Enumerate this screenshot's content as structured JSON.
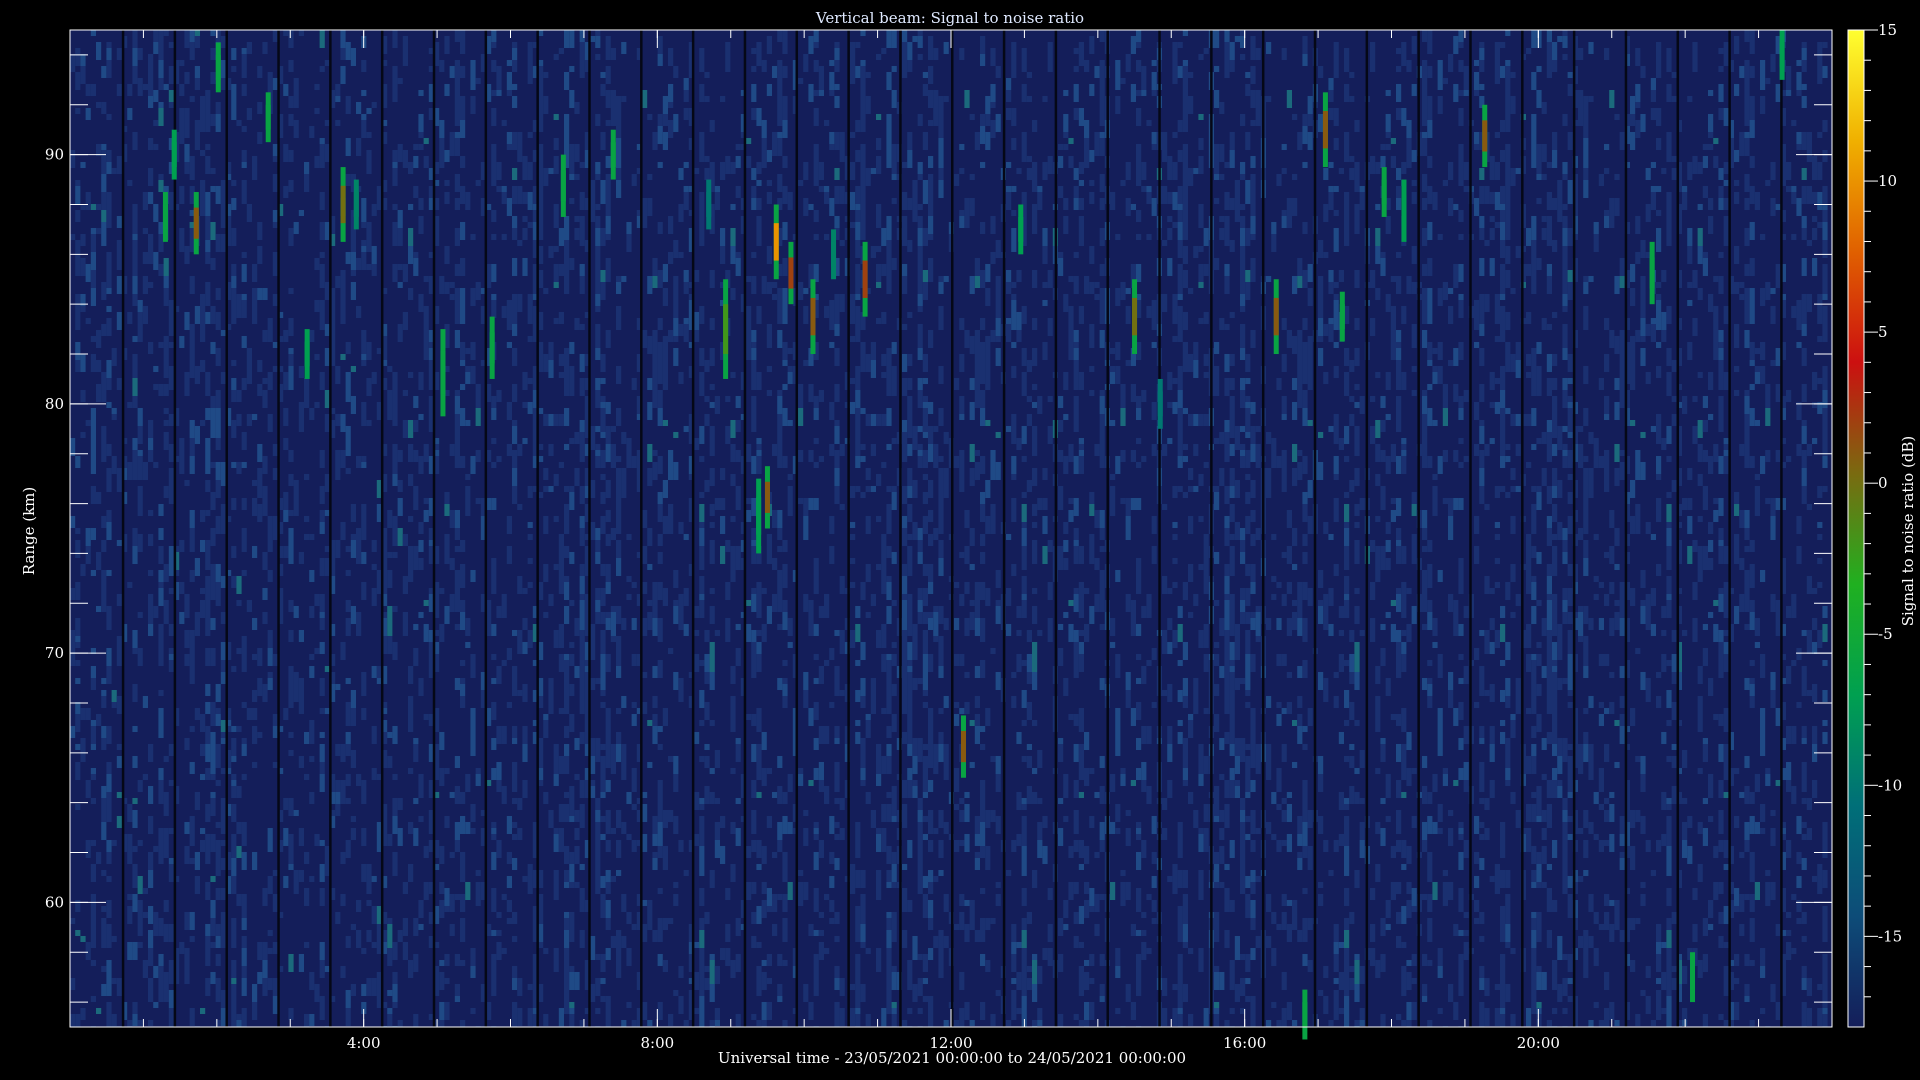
{
  "chart_data": {
    "type": "heatmap",
    "title": "Vertical beam: Signal to noise ratio",
    "xlabel": "Universal time - 23/05/2021 00:00:00 to 24/05/2021 00:00:00",
    "ylabel": "Range (km)",
    "x_unit": "hours UT",
    "xlim": [
      0,
      24
    ],
    "ylim": [
      55,
      95
    ],
    "x_ticks": [
      {
        "value": 4,
        "label": "4:00"
      },
      {
        "value": 8,
        "label": "8:00"
      },
      {
        "value": 12,
        "label": "12:00"
      },
      {
        "value": 16,
        "label": "16:00"
      },
      {
        "value": 20,
        "label": "20:00"
      }
    ],
    "y_ticks": [
      {
        "value": 60,
        "label": "60"
      },
      {
        "value": 70,
        "label": "70"
      },
      {
        "value": 80,
        "label": "80"
      },
      {
        "value": 90,
        "label": "90"
      }
    ],
    "colorbar": {
      "label": "Signal to noise ratio (dB)",
      "range": [
        -18,
        15
      ],
      "ticks": [
        {
          "value": 15,
          "label": "15"
        },
        {
          "value": 10,
          "label": "10"
        },
        {
          "value": 5,
          "label": "5"
        },
        {
          "value": 0,
          "label": "0"
        },
        {
          "value": -5,
          "label": "-5"
        },
        {
          "value": -10,
          "label": "-10"
        },
        {
          "value": -15,
          "label": "-15"
        }
      ],
      "colors": [
        "#141e5a",
        "#0d4c78",
        "#006f78",
        "#00a050",
        "#20b020",
        "#7a6a10",
        "#cc1010",
        "#e06000",
        "#f0b000",
        "#ffff30"
      ]
    },
    "background_snr": -17,
    "echoes": [
      {
        "t": 1.3,
        "r0": 86.5,
        "r1": 88.5,
        "snr": -6
      },
      {
        "t": 1.42,
        "r0": 89.0,
        "r1": 91.0,
        "snr": -7
      },
      {
        "t": 1.72,
        "r0": 86.0,
        "r1": 88.5,
        "snr": 1
      },
      {
        "t": 2.02,
        "r0": 92.5,
        "r1": 94.5,
        "snr": -6
      },
      {
        "t": 2.7,
        "r0": 90.5,
        "r1": 92.5,
        "snr": -6
      },
      {
        "t": 3.23,
        "r0": 81.0,
        "r1": 83.0,
        "snr": -7
      },
      {
        "t": 3.72,
        "r0": 86.5,
        "r1": 89.5,
        "snr": 0
      },
      {
        "t": 3.9,
        "r0": 87.0,
        "r1": 89.0,
        "snr": -9
      },
      {
        "t": 5.08,
        "r0": 79.5,
        "r1": 83.0,
        "snr": -6
      },
      {
        "t": 5.75,
        "r0": 81.0,
        "r1": 83.5,
        "snr": -6
      },
      {
        "t": 6.72,
        "r0": 87.5,
        "r1": 90.0,
        "snr": -6
      },
      {
        "t": 7.4,
        "r0": 89.0,
        "r1": 91.0,
        "snr": -6
      },
      {
        "t": 8.7,
        "r0": 87.0,
        "r1": 89.0,
        "snr": -10
      },
      {
        "t": 8.93,
        "r0": 81.0,
        "r1": 85.0,
        "snr": -2
      },
      {
        "t": 9.38,
        "r0": 74.0,
        "r1": 77.0,
        "snr": -7
      },
      {
        "t": 9.5,
        "r0": 75.0,
        "r1": 77.5,
        "snr": 1
      },
      {
        "t": 9.62,
        "r0": 85.0,
        "r1": 88.0,
        "snr": 10
      },
      {
        "t": 9.82,
        "r0": 84.0,
        "r1": 86.5,
        "snr": 2
      },
      {
        "t": 10.12,
        "r0": 82.0,
        "r1": 85.0,
        "snr": 1
      },
      {
        "t": 10.4,
        "r0": 85.0,
        "r1": 87.0,
        "snr": -9
      },
      {
        "t": 10.83,
        "r0": 83.5,
        "r1": 86.5,
        "snr": 2
      },
      {
        "t": 12.17,
        "r0": 65.0,
        "r1": 67.5,
        "snr": 1
      },
      {
        "t": 12.95,
        "r0": 86.0,
        "r1": 88.0,
        "snr": -7
      },
      {
        "t": 14.5,
        "r0": 82.0,
        "r1": 85.0,
        "snr": 0
      },
      {
        "t": 14.85,
        "r0": 79.0,
        "r1": 81.0,
        "snr": -10
      },
      {
        "t": 16.43,
        "r0": 82.0,
        "r1": 85.0,
        "snr": 1
      },
      {
        "t": 16.82,
        "r0": 54.5,
        "r1": 56.5,
        "snr": -6
      },
      {
        "t": 17.1,
        "r0": 89.5,
        "r1": 92.5,
        "snr": 1
      },
      {
        "t": 17.33,
        "r0": 82.5,
        "r1": 84.5,
        "snr": -6
      },
      {
        "t": 17.9,
        "r0": 87.5,
        "r1": 89.5,
        "snr": -6
      },
      {
        "t": 18.17,
        "r0": 86.5,
        "r1": 89.0,
        "snr": -7
      },
      {
        "t": 19.27,
        "r0": 89.5,
        "r1": 92.0,
        "snr": 1
      },
      {
        "t": 21.55,
        "r0": 84.0,
        "r1": 86.5,
        "snr": -6
      },
      {
        "t": 22.1,
        "r0": 56.0,
        "r1": 58.0,
        "snr": -6
      },
      {
        "t": 23.32,
        "r0": 93.0,
        "r1": 95.0,
        "snr": -7
      }
    ]
  }
}
